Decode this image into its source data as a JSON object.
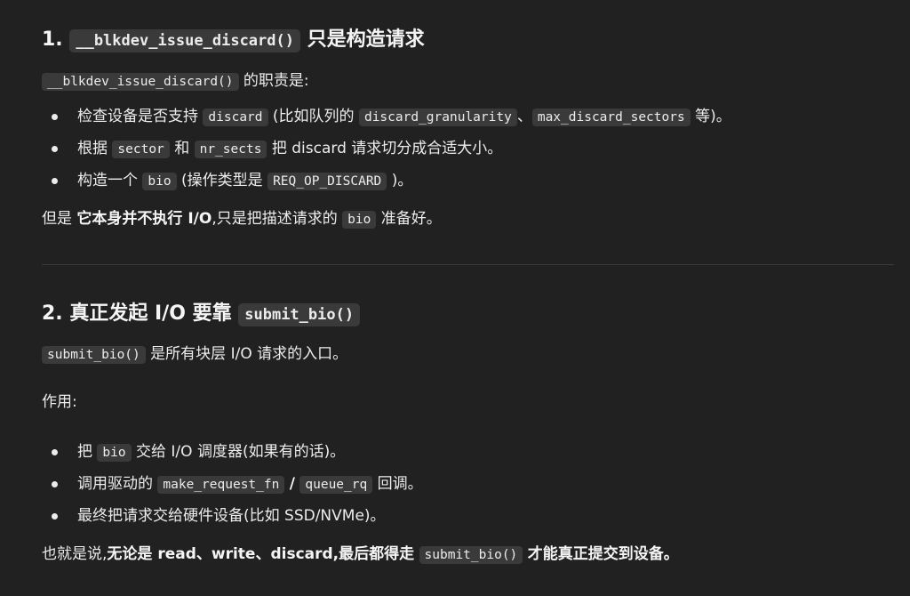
{
  "section1": {
    "heading": {
      "num": "1.",
      "code": "__blkdev_issue_discard()",
      "text": "只是构造请求"
    },
    "intro": {
      "code": "__blkdev_issue_discard()",
      "text": "的职责是:"
    },
    "bullets": [
      {
        "t1": "检查设备是否支持",
        "c1": "discard",
        "t2": "(比如队列的",
        "c2": "discard_granularity",
        "t3": "、",
        "c3": "max_discard_sectors",
        "t4": "等)。"
      },
      {
        "t1": "根据",
        "c1": "sector",
        "t2": "和",
        "c2": "nr_sects",
        "t3": "把 discard 请求切分成合适大小。"
      },
      {
        "t1": "构造一个",
        "c1": "bio",
        "t2": "(操作类型是",
        "c2": "REQ_OP_DISCARD",
        "t3": ")。"
      }
    ],
    "summary": {
      "t1": "但是",
      "strong": "它本身并不执行 I/O",
      "t2": ",只是把描述请求的",
      "code": "bio",
      "t3": "准备好。"
    }
  },
  "section2": {
    "heading": {
      "text": "2. 真正发起 I/O 要靠",
      "code": "submit_bio()"
    },
    "intro": {
      "code": "submit_bio()",
      "text": "是所有块层 I/O 请求的入口。"
    },
    "role_label": "作用:",
    "bullets": [
      {
        "t1": "把",
        "c1": "bio",
        "t2": "交给 I/O 调度器(如果有的话)。"
      },
      {
        "t1": "调用驱动的",
        "c1": "make_request_fn",
        "t2": "/",
        "c2": "queue_rq",
        "t3": "回调。"
      },
      {
        "t1": "最终把请求交给硬件设备(比如 SSD/NVMe)。"
      }
    ],
    "summary": {
      "t1": "也就是说,",
      "strong1": "无论是 read、write、discard,最后都得走",
      "code": "submit_bio()",
      "strong2": "才能真正提交到设备。"
    }
  }
}
